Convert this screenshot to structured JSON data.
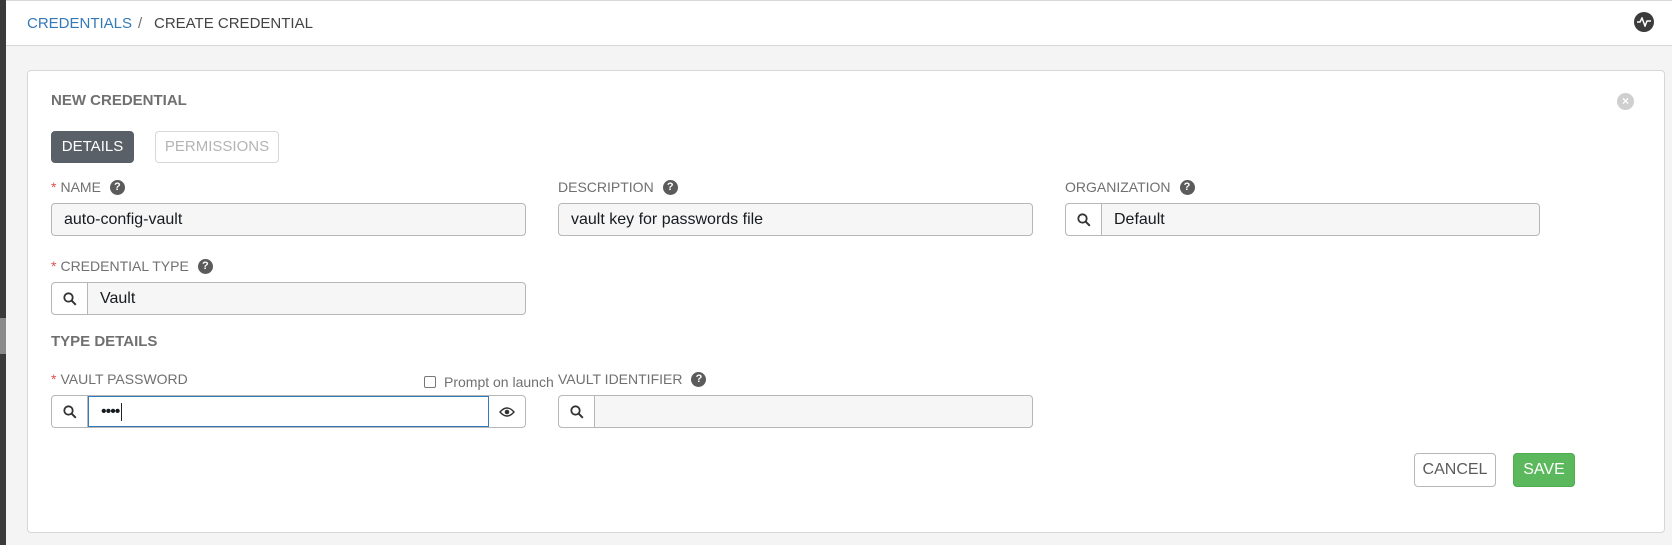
{
  "breadcrumb": {
    "parent": "CREDENTIALS",
    "separator": "/",
    "current": "CREATE CREDENTIAL"
  },
  "topbar": {
    "activity_icon": "activity-stream-icon"
  },
  "panel": {
    "title": "NEW CREDENTIAL",
    "close_icon": "close-icon",
    "tabs": [
      {
        "label": "DETAILS",
        "active": true
      },
      {
        "label": "PERMISSIONS",
        "active": false
      }
    ]
  },
  "fields": {
    "name": {
      "required": "*",
      "label": "NAME",
      "value": "auto-config-vault"
    },
    "description": {
      "label": "DESCRIPTION",
      "value": "vault key for passwords file"
    },
    "organization": {
      "label": "ORGANIZATION",
      "value": "Default"
    },
    "credential_type": {
      "required": "*",
      "label": "CREDENTIAL TYPE",
      "value": "Vault"
    }
  },
  "type_details": {
    "title": "TYPE DETAILS",
    "vault_password": {
      "required": "*",
      "label": "VAULT PASSWORD",
      "value": "••••",
      "prompt_label": "Prompt on launch",
      "prompt_checked": false
    },
    "vault_identifier": {
      "label": "VAULT IDENTIFIER",
      "value": ""
    }
  },
  "actions": {
    "cancel": "CANCEL",
    "save": "SAVE"
  },
  "colors": {
    "link": "#337ab7",
    "required": "#d9534f",
    "save": "#5cb85c",
    "active_tab": "#5a6068"
  }
}
